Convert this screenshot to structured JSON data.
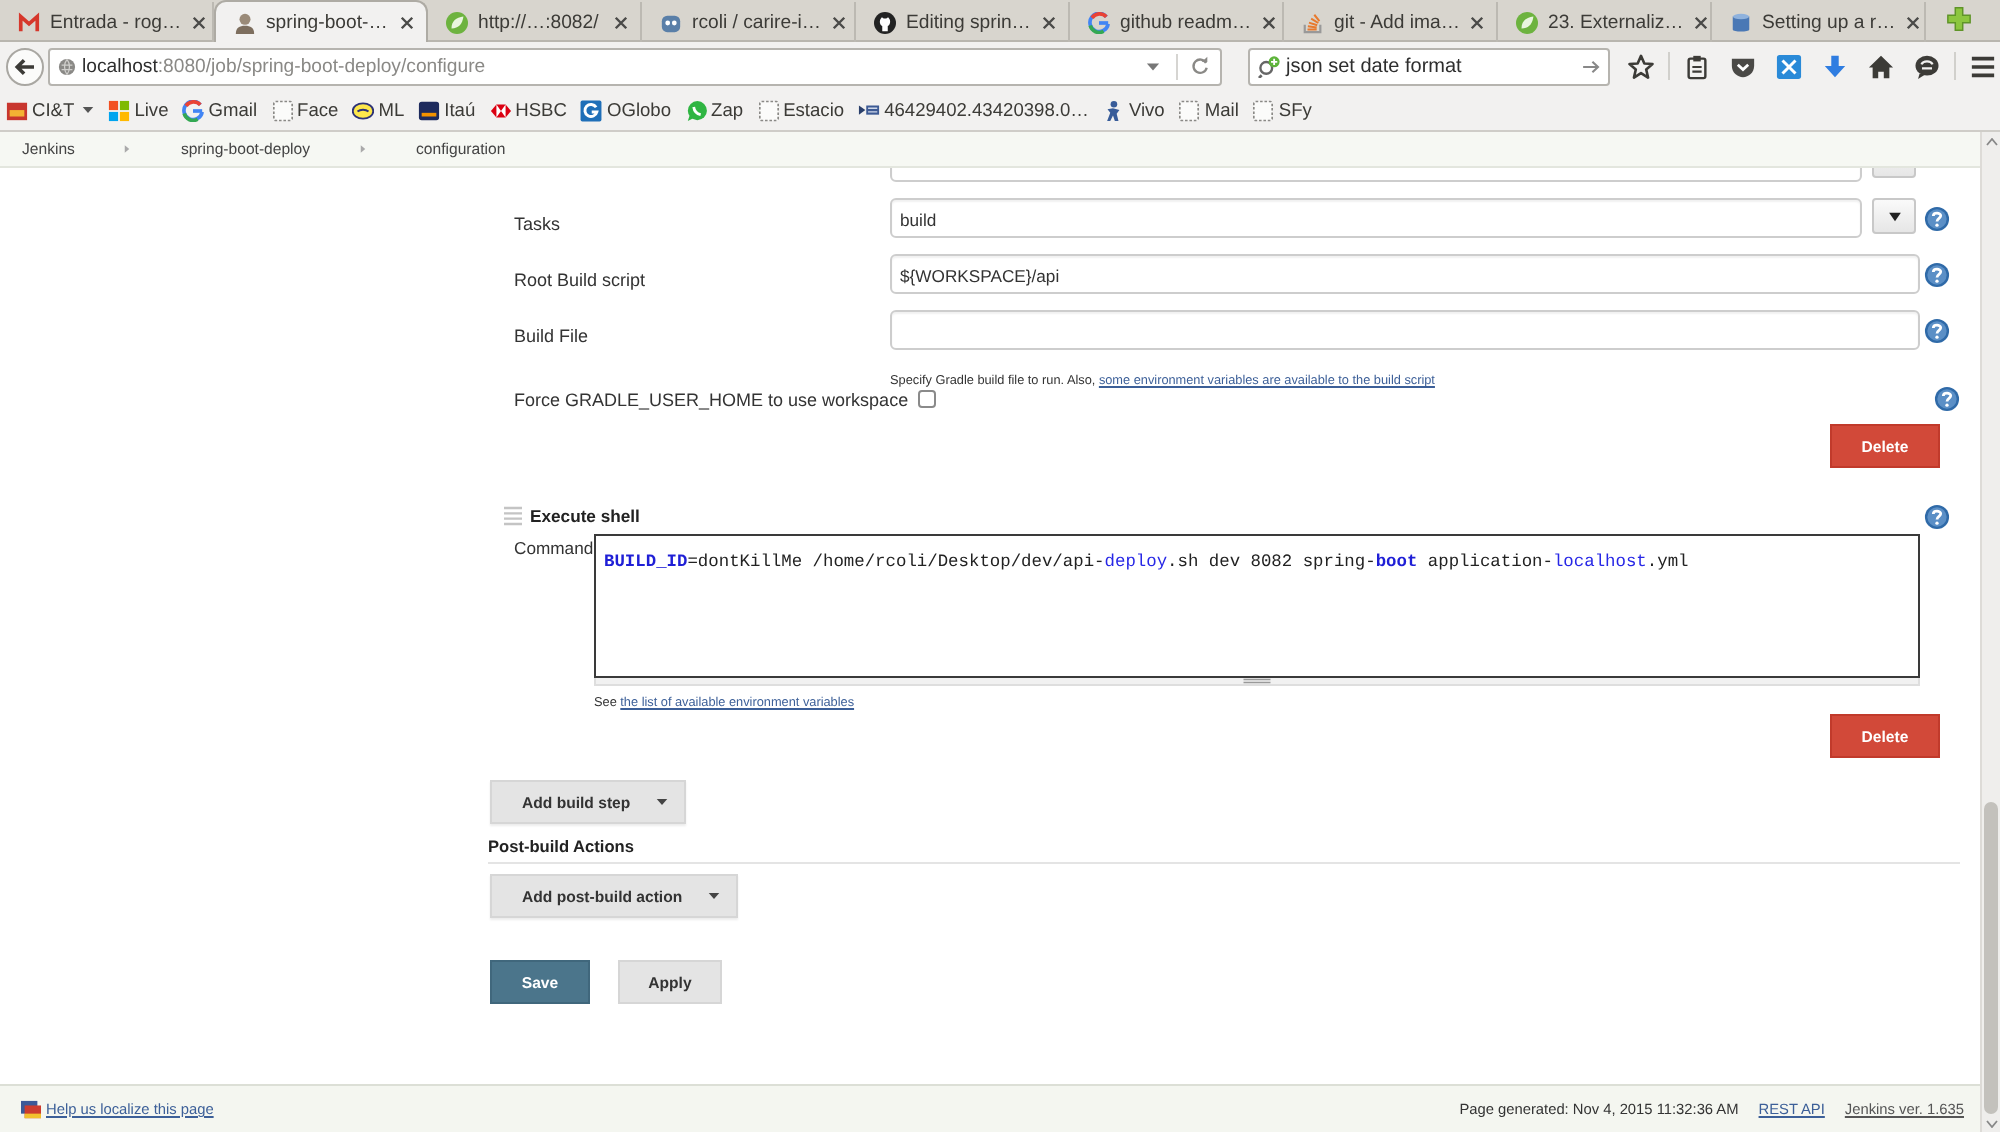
{
  "browser": {
    "tabs": [
      {
        "title": "Entrada - rog…",
        "kind": "mail",
        "selected": false
      },
      {
        "title": "spring-boot-…",
        "kind": "avatar",
        "selected": true
      },
      {
        "title": "http://…:8082/",
        "kind": "leaf",
        "selected": false
      },
      {
        "title": "rcoli / carire-i…",
        "kind": "robot",
        "selected": false
      },
      {
        "title": "Editing sprin…",
        "kind": "github",
        "selected": false
      },
      {
        "title": "github readm…",
        "kind": "google",
        "selected": false
      },
      {
        "title": "git - Add ima…",
        "kind": "stack",
        "selected": false
      },
      {
        "title": "23. Externaliz…",
        "kind": "leaf",
        "selected": false
      },
      {
        "title": "Setting up a r…",
        "kind": "database",
        "selected": false
      }
    ],
    "address": {
      "host": "localhost",
      "path": ":8080/job/spring-boot-deploy/configure"
    },
    "search": {
      "value": "json set date format"
    },
    "bookmarks": [
      {
        "label": "CI&T",
        "kind": "folder"
      },
      {
        "label": "Live",
        "kind": "tiles"
      },
      {
        "label": "Gmail",
        "kind": "google"
      },
      {
        "label": "Face",
        "kind": "page"
      },
      {
        "label": "ML",
        "kind": "oval"
      },
      {
        "label": "Itaú",
        "kind": "card"
      },
      {
        "label": "HSBC",
        "kind": "hexagon"
      },
      {
        "label": "OGlobo",
        "kind": "globo"
      },
      {
        "label": "Zap",
        "kind": "chat"
      },
      {
        "label": "Estacio",
        "kind": "page"
      },
      {
        "label": "46429402.43420398.0…",
        "kind": "site"
      },
      {
        "label": "Vivo",
        "kind": "person"
      },
      {
        "label": "Mail",
        "kind": "page"
      },
      {
        "label": "SFy",
        "kind": "page"
      }
    ]
  },
  "breadcrumbs": [
    "Jenkins",
    "spring-boot-deploy",
    "configuration"
  ],
  "gradle": {
    "fields": [
      {
        "label": "Tasks",
        "value": "build",
        "kind": "combo"
      },
      {
        "label": "Root Build script",
        "value": "${WORKSPACE}/api",
        "kind": "text"
      },
      {
        "label": "Build File",
        "kind": "text",
        "hint": "Specify Gradle build file to run. Also,",
        "hint_link": "some environment variables are available to the build script"
      }
    ],
    "option": {
      "label": "Force GRADLE_USER_HOME to use workspace",
      "checked": false
    },
    "delete": "Delete"
  },
  "execute_shell": {
    "title": "Execute shell",
    "label": "Command",
    "command": [
      {
        "text": "BUILD_ID",
        "kind": "variable"
      },
      {
        "text": "=dontKillMe /home/rcoli/Desktop/dev/api-",
        "kind": "plain"
      },
      {
        "text": "deploy",
        "kind": "keyword"
      },
      {
        "text": ".sh dev 8082 spring-",
        "kind": "plain"
      },
      {
        "text": "boot",
        "kind": "variable"
      },
      {
        "text": " application-",
        "kind": "plain"
      },
      {
        "text": "localhost",
        "kind": "keyword"
      },
      {
        "text": ".yml",
        "kind": "plain"
      }
    ],
    "hint": "See",
    "hint_link": "the list of available environment variables",
    "delete": "Delete"
  },
  "add_build_step": "Add build step",
  "post_build": {
    "title": "Post-build Actions",
    "button": "Add post-build action"
  },
  "actions": [
    {
      "label": "Save",
      "kind": "primary"
    },
    {
      "label": "Apply",
      "kind": "secondary"
    }
  ],
  "footer": {
    "localize": "Help us localize this page",
    "generated": "Page generated: Nov 4, 2015 11:32:36 AM",
    "links": [
      "REST API",
      "Jenkins ver. 1.635"
    ]
  }
}
